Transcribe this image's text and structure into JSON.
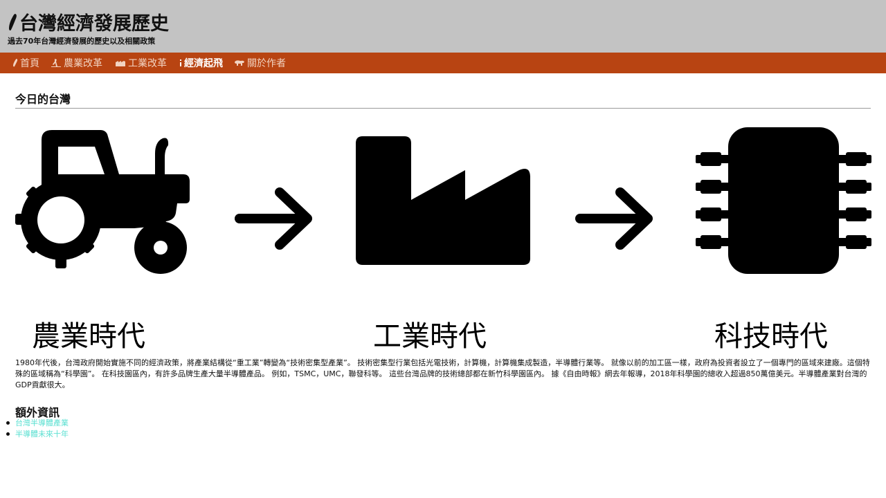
{
  "header": {
    "title": "台灣經濟發展歷史",
    "subtitle": "過去70年台灣經濟發展的歷史以及相關政策"
  },
  "nav": {
    "items": [
      {
        "label": "首頁",
        "icon": "taiwan-island-icon",
        "active": false
      },
      {
        "label": "農業改革",
        "icon": "farmer-icon",
        "active": false
      },
      {
        "label": "工業改革",
        "icon": "factory-icon",
        "active": false
      },
      {
        "label": "經濟起飛",
        "icon": "chart-icon",
        "active": true
      },
      {
        "label": "關於作者",
        "icon": "bear-icon",
        "active": false
      }
    ]
  },
  "main": {
    "section_title": "今日的台灣",
    "eras": [
      {
        "label": "農業時代",
        "icon": "tractor-icon"
      },
      {
        "label": "工業時代",
        "icon": "factory-icon"
      },
      {
        "label": "科技時代",
        "icon": "microchip-icon"
      }
    ],
    "paragraph": "1980年代後，台灣政府開始實施不同的經濟政策，將產業結構從“重工業”轉變為“技術密集型產業”。 技術密集型行業包括光電技術，計算機，計算機集成製造，半導體行業等。 就像以前的加工區一樣，政府為投資者設立了一個專門的區域來建廠。這個特殊的區域稱為“科學園”。 在科技園區內，有許多品牌生產大量半導體產品。 例如，TSMC，UMC，聯發科等。 這些台灣品牌的技術總部都在新竹科學園區內。 據《自由時報》網去年報導，2018年科學園的總收入超過850萬億美元。半導體產業對台灣的GDP貢獻很大。",
    "extra_title": "額外資訊",
    "links": [
      {
        "label": "台灣半導體產業"
      },
      {
        "label": "半導體未來十年"
      }
    ]
  },
  "colors": {
    "header_bg": "#c3c3c3",
    "nav_bg": "#b84412",
    "nav_text": "#f2d3c1",
    "link": "#5ce0d2"
  }
}
